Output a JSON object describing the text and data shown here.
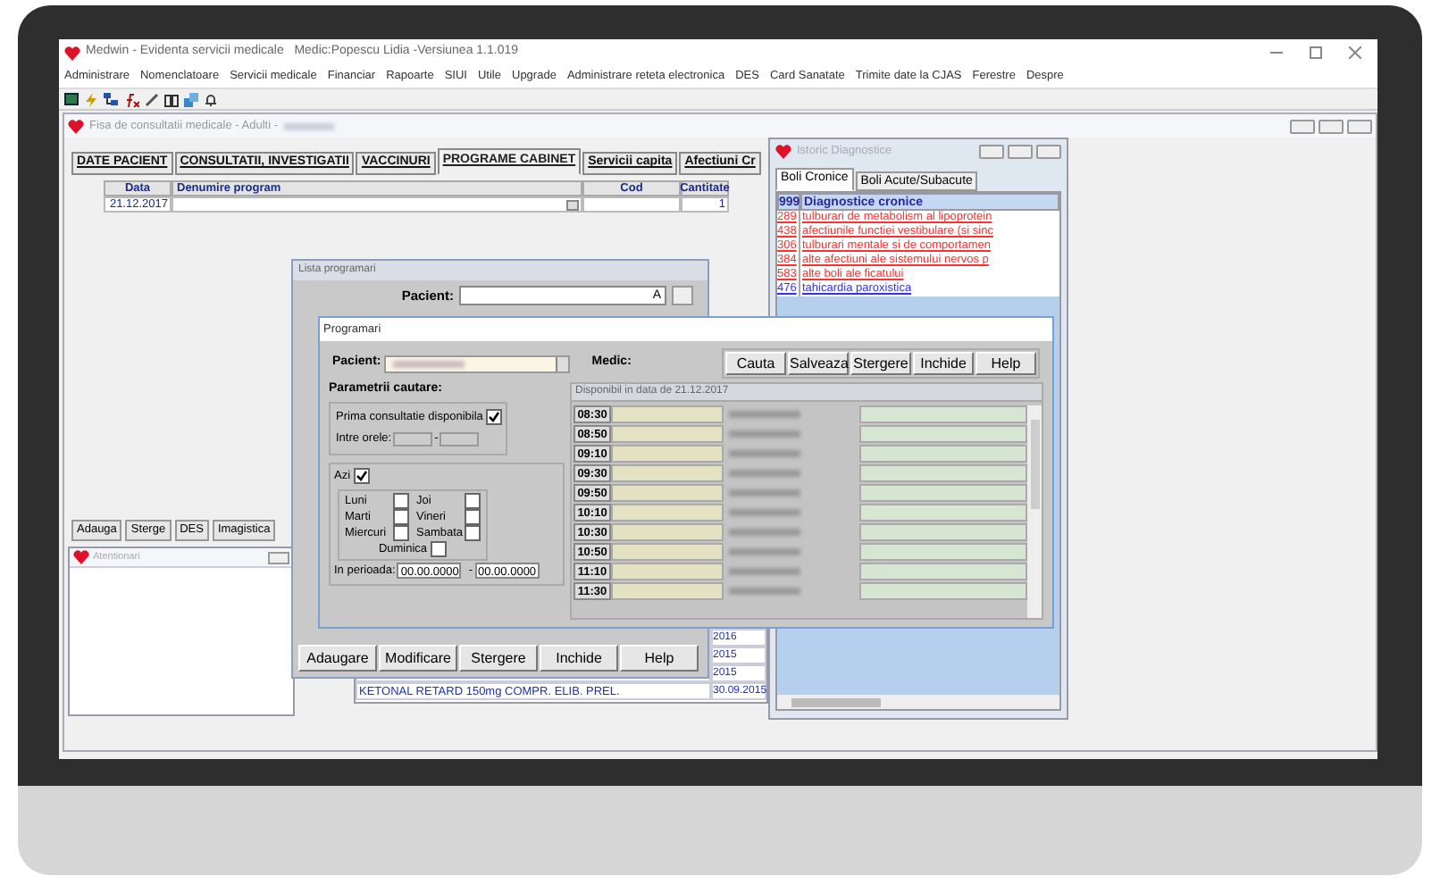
{
  "window": {
    "title": "Medwin - Evidenta servicii medicale   Medic:Popescu Lidia -Versiunea 1.1.019"
  },
  "menu": [
    "Administrare",
    "Nomenclatoare",
    "Servicii medicale",
    "Financiar",
    "Rapoarte",
    "SIUI",
    "Utile",
    "Upgrade",
    "Administrare reteta electronica",
    "DES",
    "Card Sanatate",
    "Trimite date la CJAS",
    "Ferestre",
    "Despre"
  ],
  "fisa": {
    "title": "Fisa de consultatii medicale - Adulti -",
    "tabs": [
      {
        "label": "DATE PACIENT",
        "selected": false
      },
      {
        "label": "CONSULTATII, INVESTIGATII",
        "selected": false
      },
      {
        "label": "VACCINURI",
        "selected": false
      },
      {
        "label": "PROGRAME CABINET",
        "selected": true
      },
      {
        "label": "Servicii capita",
        "selected": false
      },
      {
        "label": "Afectiuni Cr",
        "selected": false
      }
    ],
    "table": {
      "columns": [
        "Data",
        "Denumire program",
        "Cod",
        "Cantitate"
      ],
      "rows": [
        [
          "21.12.2017",
          "",
          "",
          "1"
        ]
      ]
    },
    "buttons": [
      "Adauga",
      "Sterge",
      "DES",
      "Imagistica"
    ],
    "history_rows": [
      [
        "",
        "2016"
      ],
      [
        "",
        "2015"
      ],
      [
        "",
        "2015"
      ],
      [
        "KETONAL RETARD 150mg COMPR. ELIB. PREL.",
        "30.09.2015"
      ]
    ]
  },
  "atentionari": {
    "title": "Atentionari"
  },
  "istoric": {
    "title": "Istoric Diagnostice",
    "tabs": [
      {
        "label": "Boli Cronice",
        "selected": true
      },
      {
        "label": "Boli Acute/Subacute",
        "selected": false
      }
    ],
    "header": {
      "code": "999",
      "text": "Diagnostice cronice"
    },
    "rows": [
      {
        "code": "289",
        "text": "tulburari de metabolism al lipoprotein",
        "color": "#ff3030"
      },
      {
        "code": "438",
        "text": "afectiunile functiei vestibulare (si sinc",
        "color": "#ff3030"
      },
      {
        "code": "306",
        "text": "tulburari mentale si de comportamen",
        "color": "#ff3030"
      },
      {
        "code": "384",
        "text": "alte afectiuni ale sistemului nervos p",
        "color": "#ff3030"
      },
      {
        "code": "583",
        "text": "alte boli ale ficatului",
        "color": "#ff3030"
      },
      {
        "code": "476",
        "text": "tahicardia paroxistica",
        "color": "#3030ff"
      }
    ]
  },
  "lista": {
    "title": "Lista programari",
    "patient_label": "Pacient:",
    "patient_value": "A",
    "buttons": [
      "Adaugare",
      "Modificare",
      "Stergere",
      "Inchide",
      "Help"
    ]
  },
  "programari": {
    "title": "Programari",
    "patient_label": "Pacient:",
    "medic_label": "Medic:",
    "buttons": [
      "Cauta",
      "Salveaza",
      "Stergere",
      "Inchide",
      "Help"
    ],
    "params_title": "Parametrii cautare:",
    "first_available": {
      "label": "Prima consultatie disponibila",
      "checked": true
    },
    "between_label": "Intre orele:",
    "between_sep": "-",
    "today": {
      "label": "Azi",
      "checked": true
    },
    "days": [
      {
        "label": "Luni",
        "checked": false
      },
      {
        "label": "Joi",
        "checked": false
      },
      {
        "label": "Marti",
        "checked": false
      },
      {
        "label": "Vineri",
        "checked": false
      },
      {
        "label": "Miercuri",
        "checked": false
      },
      {
        "label": "Sambata",
        "checked": false
      },
      {
        "label": "Duminica",
        "checked": false
      }
    ],
    "period_label": "In perioada:",
    "period_from": "00.00.0000",
    "period_sep": "-",
    "period_to": "00.00.0000",
    "grid_title": "Disponibil in data de 21.12.2017",
    "slots": [
      "08:30",
      "08:50",
      "09:10",
      "09:30",
      "09:50",
      "10:10",
      "10:30",
      "10:50",
      "11:10",
      "11:30"
    ]
  }
}
